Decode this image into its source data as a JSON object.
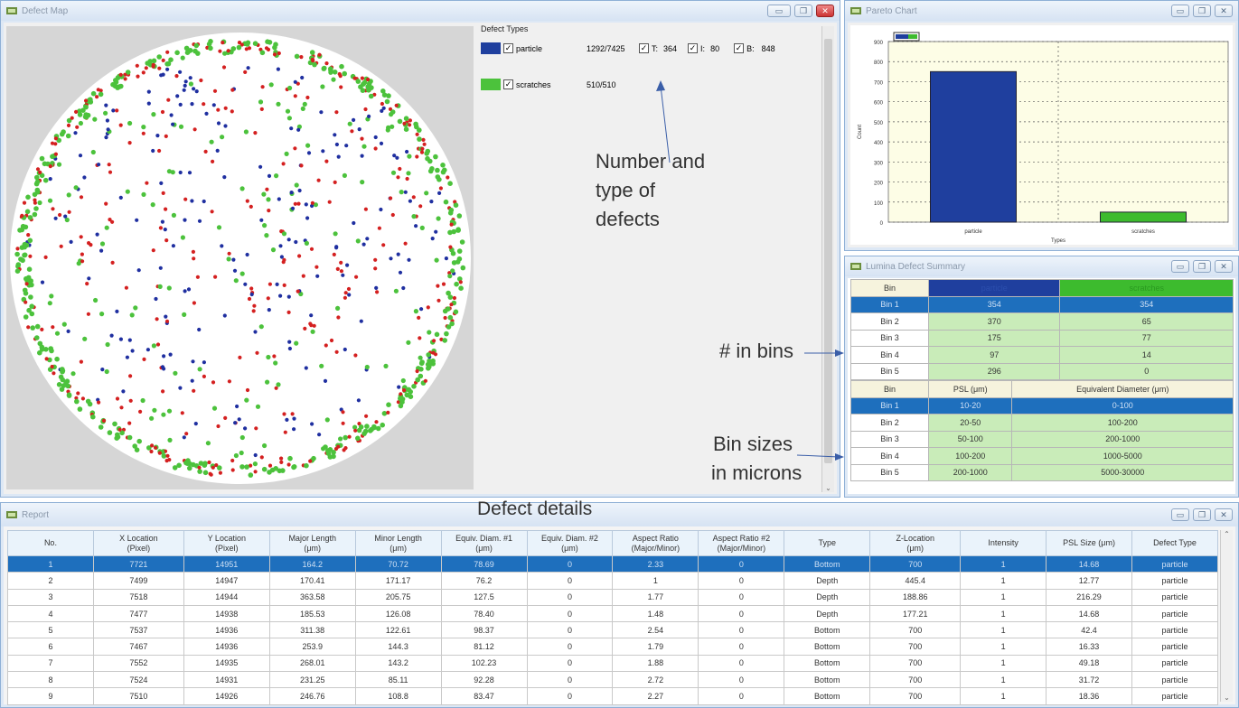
{
  "defect_map": {
    "title": "Defect Map",
    "header": "Defect Types",
    "types": [
      {
        "name": "particle",
        "count": "1292/7425",
        "color": "#1f3f9e",
        "sub": [
          {
            "label": "T:",
            "value": "364"
          },
          {
            "label": "I:",
            "value": "80"
          },
          {
            "label": "B:",
            "value": "848"
          }
        ]
      },
      {
        "name": "scratches",
        "count": "510/510",
        "color": "#4cc23c"
      }
    ],
    "annotation": [
      "Number and",
      "type of",
      "defects"
    ],
    "dot_colors": {
      "blue": "#1f2fa0",
      "red": "#d42020",
      "green": "#4cc23c"
    }
  },
  "pareto": {
    "title": "Pareto Chart",
    "ylabel": "Count",
    "xlabel": "Types"
  },
  "chart_data": {
    "type": "bar",
    "categories": [
      "particle",
      "scratches"
    ],
    "values": [
      750,
      50
    ],
    "colors": [
      "#1f3f9e",
      "#3dbb2e"
    ],
    "xlabel": "Types",
    "ylabel": "Count",
    "ylim": [
      0,
      900
    ],
    "yticks": [
      0,
      100,
      200,
      300,
      400,
      500,
      600,
      700,
      800,
      900
    ],
    "grid": true
  },
  "summary": {
    "title": "Lumina Defect Summary",
    "count_header": {
      "bin": "Bin",
      "c1": "particle",
      "c2": "scratches"
    },
    "counts": [
      {
        "bin": "Bin 1",
        "a": "354",
        "b": "354"
      },
      {
        "bin": "Bin 2",
        "a": "370",
        "b": "65"
      },
      {
        "bin": "Bin 3",
        "a": "175",
        "b": "77"
      },
      {
        "bin": "Bin 4",
        "a": "97",
        "b": "14"
      },
      {
        "bin": "Bin 5",
        "a": "296",
        "b": "0"
      }
    ],
    "size_header": {
      "bin": "Bin",
      "c1": "PSL (μm)",
      "c2": "Equivalent Diameter (μm)"
    },
    "sizes": [
      {
        "bin": "Bin 1",
        "a": "10-20",
        "b": "0-100"
      },
      {
        "bin": "Bin 2",
        "a": "20-50",
        "b": "100-200"
      },
      {
        "bin": "Bin 3",
        "a": "50-100",
        "b": "200-1000"
      },
      {
        "bin": "Bin 4",
        "a": "100-200",
        "b": "1000-5000"
      },
      {
        "bin": "Bin 5",
        "a": "200-1000",
        "b": "5000-30000"
      }
    ],
    "annot_bins": "# in bins",
    "annot_sizes": [
      "Bin sizes",
      "in microns"
    ]
  },
  "report": {
    "title": "Report",
    "overlay_title": "Defect details",
    "columns": [
      "No.",
      "X Location\n(Pixel)",
      "Y Location\n(Pixel)",
      "Major Length\n(μm)",
      "Minor Length\n(μm)",
      "Equiv. Diam. #1\n(μm)",
      "Equiv. Diam. #2\n(μm)",
      "Aspect Ratio\n(Major/Minor)",
      "Aspect Ratio #2\n(Major/Minor)",
      "Type",
      "Z-Location\n(μm)",
      "Intensity",
      "PSL Size (μm)",
      "Defect Type"
    ],
    "rows": [
      [
        "1",
        "7721",
        "14951",
        "164.2",
        "70.72",
        "78.69",
        "0",
        "2.33",
        "0",
        "Bottom",
        "700",
        "1",
        "14.68",
        "particle"
      ],
      [
        "2",
        "7499",
        "14947",
        "170.41",
        "171.17",
        "76.2",
        "0",
        "1",
        "0",
        "Depth",
        "445.4",
        "1",
        "12.77",
        "particle"
      ],
      [
        "3",
        "7518",
        "14944",
        "363.58",
        "205.75",
        "127.5",
        "0",
        "1.77",
        "0",
        "Depth",
        "188.86",
        "1",
        "216.29",
        "particle"
      ],
      [
        "4",
        "7477",
        "14938",
        "185.53",
        "126.08",
        "78.40",
        "0",
        "1.48",
        "0",
        "Depth",
        "177.21",
        "1",
        "14.68",
        "particle"
      ],
      [
        "5",
        "7537",
        "14936",
        "311.38",
        "122.61",
        "98.37",
        "0",
        "2.54",
        "0",
        "Bottom",
        "700",
        "1",
        "42.4",
        "particle"
      ],
      [
        "6",
        "7467",
        "14936",
        "253.9",
        "144.3",
        "81.12",
        "0",
        "1.79",
        "0",
        "Bottom",
        "700",
        "1",
        "16.33",
        "particle"
      ],
      [
        "7",
        "7552",
        "14935",
        "268.01",
        "143.2",
        "102.23",
        "0",
        "1.88",
        "0",
        "Bottom",
        "700",
        "1",
        "49.18",
        "particle"
      ],
      [
        "8",
        "7524",
        "14931",
        "231.25",
        "85.11",
        "92.28",
        "0",
        "2.72",
        "0",
        "Bottom",
        "700",
        "1",
        "31.72",
        "particle"
      ],
      [
        "9",
        "7510",
        "14926",
        "246.76",
        "108.8",
        "83.47",
        "0",
        "2.27",
        "0",
        "Bottom",
        "700",
        "1",
        "18.36",
        "particle"
      ]
    ]
  }
}
